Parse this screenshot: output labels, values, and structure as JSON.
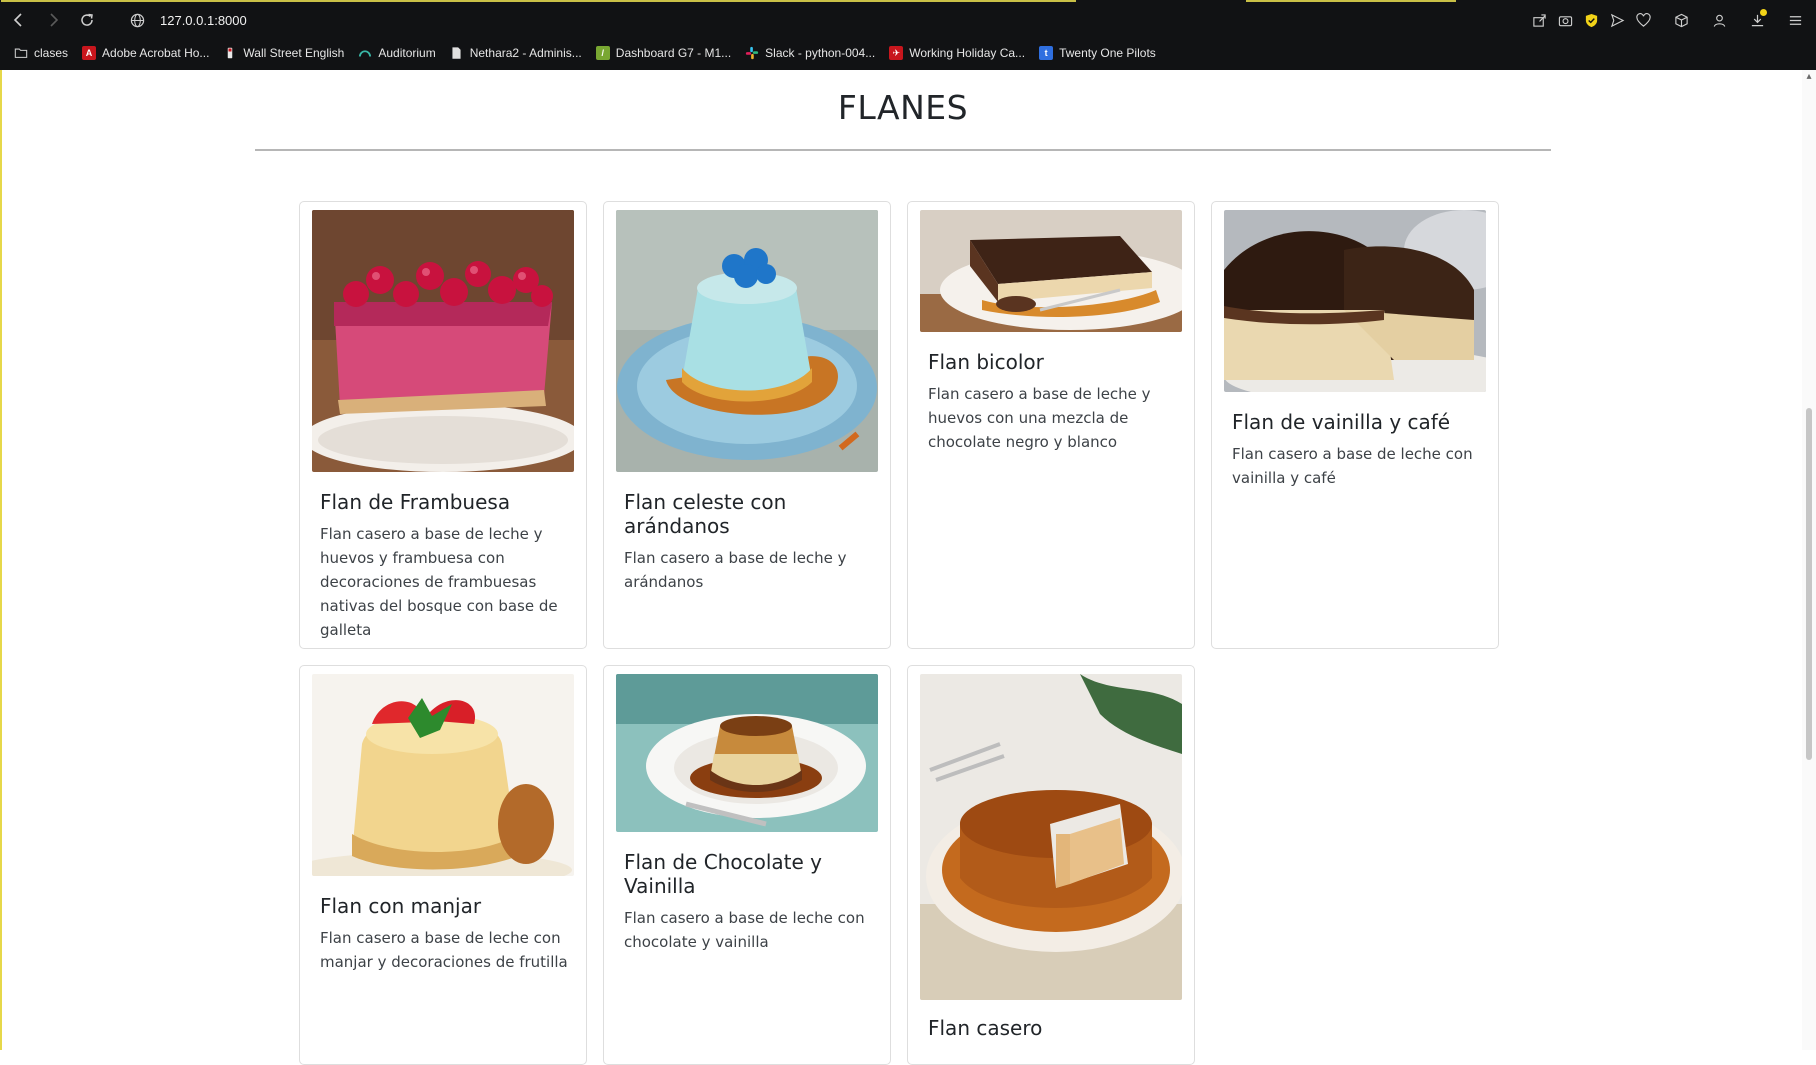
{
  "browser": {
    "url": "127.0.0.1:8000",
    "bookmarks": [
      {
        "label": "clases",
        "icon": "folder-icon"
      },
      {
        "label": "Adobe Acrobat Ho...",
        "icon": "adobe-icon"
      },
      {
        "label": "Wall Street English",
        "icon": "wse-icon"
      },
      {
        "label": "Auditorium",
        "icon": "auditorium-icon"
      },
      {
        "label": "Nethara2 - Adminis...",
        "icon": "document-icon"
      },
      {
        "label": "Dashboard G7 - M1...",
        "icon": "dashboard-icon"
      },
      {
        "label": "Slack - python-004...",
        "icon": "slack-icon"
      },
      {
        "label": "Working Holiday Ca...",
        "icon": "working-holiday-icon"
      },
      {
        "label": "Twenty One Pilots",
        "icon": "tumblr-icon"
      }
    ]
  },
  "page": {
    "title": "FLANES"
  },
  "cards": [
    {
      "title": "Flan de Frambuesa",
      "text": "Flan casero a base de leche y huevos y frambuesa con decoraciones de frambuesas nativas del bosque con base de galleta"
    },
    {
      "title": "Flan celeste con arándanos",
      "text": "Flan casero a base de leche y arándanos"
    },
    {
      "title": "Flan bicolor",
      "text": "Flan casero a base de leche y huevos con una mezcla de chocolate negro y blanco"
    },
    {
      "title": "Flan de vainilla y café",
      "text": "Flan casero a base de leche con vainilla y café"
    },
    {
      "title": "Flan con manjar",
      "text": "Flan casero a base de leche con manjar y decoraciones de frutilla"
    },
    {
      "title": "Flan de Chocolate y Vainilla",
      "text": "Flan casero a base de leche con chocolate y vainilla"
    },
    {
      "title": "Flan casero",
      "text": ""
    }
  ],
  "colors": {
    "chrome_bg": "#111214",
    "accent": "#c9c046",
    "text": "#212529"
  }
}
